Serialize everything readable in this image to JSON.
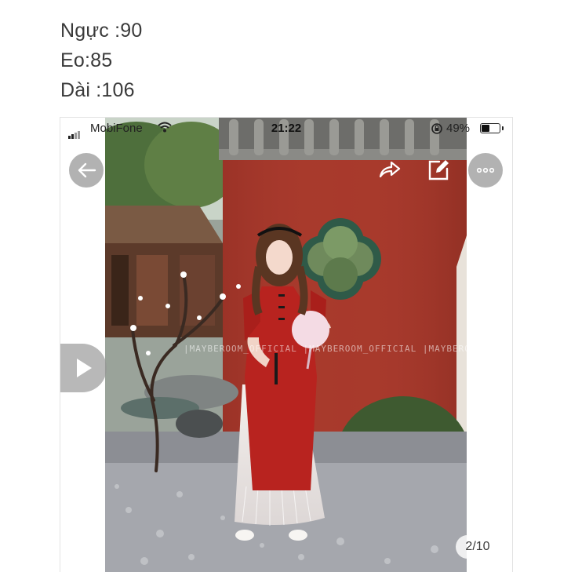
{
  "measurements": {
    "chest": "Ngực :90",
    "waist": "Eo:85",
    "length": "Dài :106"
  },
  "status_bar": {
    "carrier": "MobiFone",
    "time": "21:22",
    "battery_percent": "49%",
    "signal_icon": "signal-bars-icon",
    "wifi_icon": "wifi-icon",
    "lock_icon": "rotation-lock-icon",
    "battery_icon": "battery-icon",
    "battery_level": 0.49
  },
  "viewer": {
    "back_icon": "arrow-left-icon",
    "share_icon": "share-forward-icon",
    "edit_icon": "edit-pencil-icon",
    "more_icon": "more-dots-icon",
    "play_icon": "play-triangle-icon",
    "image_counter": "2/10"
  },
  "photo": {
    "watermark": "|MAYBEROOM_OFFICIAL |MAYBEROOM_OFFICIAL |MAYBEROOM_OFFICIAL",
    "dress_color": "#b8231f",
    "wall_color": "#a8392c"
  }
}
